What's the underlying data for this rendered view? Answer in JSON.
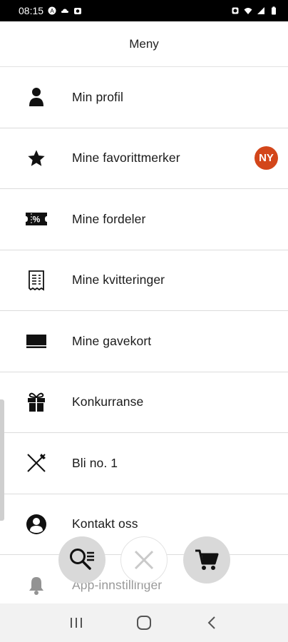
{
  "status_bar": {
    "time": "08:15",
    "left_icons": [
      "a-icon",
      "cloud-icon",
      "camera-icon"
    ],
    "right_icons": [
      "alarm-icon",
      "wifi-icon",
      "signal-icon",
      "battery-icon"
    ]
  },
  "header": {
    "title": "Meny"
  },
  "menu": {
    "items": [
      {
        "label": "Min profil",
        "icon": "person-icon"
      },
      {
        "label": "Mine favorittmerker",
        "icon": "star-icon",
        "badge": "NY"
      },
      {
        "label": "Mine fordeler",
        "icon": "coupon-icon"
      },
      {
        "label": "Mine kvitteringer",
        "icon": "receipt-icon"
      },
      {
        "label": "Mine gavekort",
        "icon": "gift-card-icon"
      },
      {
        "label": "Konkurranse",
        "icon": "gift-icon"
      },
      {
        "label": "Bli no. 1",
        "icon": "fork-knife-icon"
      },
      {
        "label": "Kontakt oss",
        "icon": "contact-icon"
      },
      {
        "label": "App-innstillinger",
        "icon": "bell-icon"
      }
    ]
  },
  "fabs": {
    "search": "search-list-icon",
    "close": "close-icon",
    "cart": "cart-icon"
  },
  "colors": {
    "badge": "#d3461a",
    "fab_grey": "#d9d9d9",
    "close_x": "#c9c9c9"
  },
  "nav": [
    "recent-apps-icon",
    "home-icon",
    "back-icon"
  ]
}
